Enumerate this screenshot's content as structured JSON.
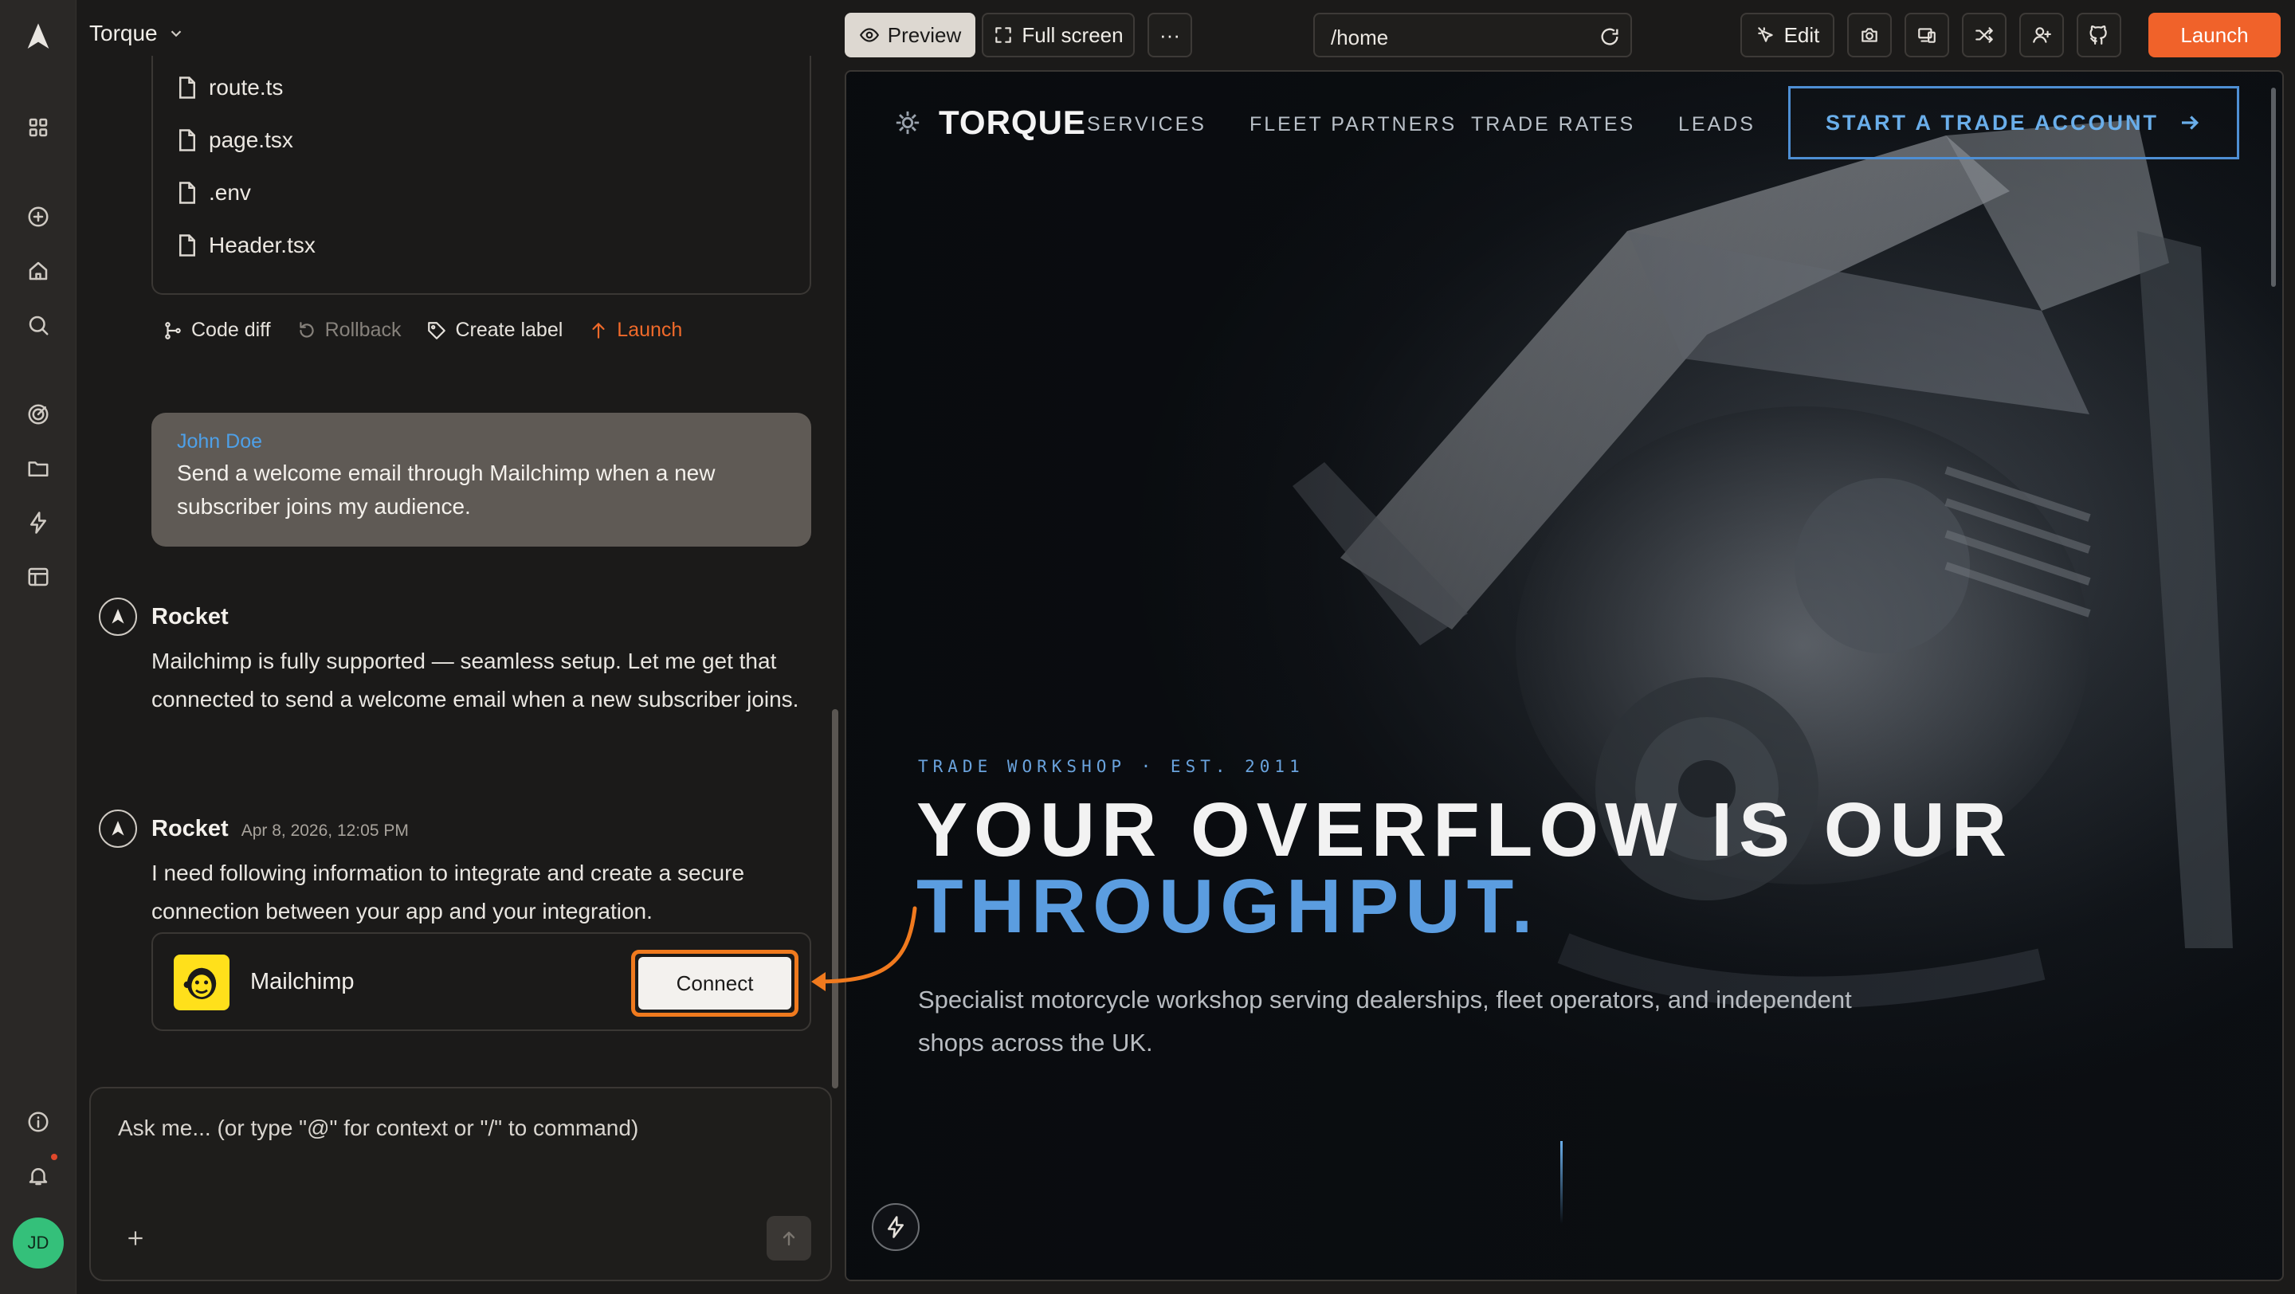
{
  "project": {
    "name": "Torque"
  },
  "files": [
    "route.ts",
    "page.tsx",
    ".env",
    "Header.tsx"
  ],
  "actions": {
    "code_diff": "Code diff",
    "rollback": "Rollback",
    "create_label": "Create label",
    "launch": "Launch"
  },
  "user_message": {
    "author": "John Doe",
    "text": "Send a welcome email through Mailchimp when a new subscriber joins my audience."
  },
  "bot_messages": [
    {
      "name": "Rocket",
      "time": "",
      "text": "Mailchimp is fully supported — seamless setup. Let me get that connected to send a welcome email when a new subscriber joins."
    },
    {
      "name": "Rocket",
      "time": "Apr 8, 2026, 12:05 PM",
      "text": "I need following information to integrate and create a secure connection between your app and your integration."
    }
  ],
  "integration": {
    "name": "Mailchimp",
    "button": "Connect"
  },
  "chat_input": {
    "placeholder": "Ask me... (or type \"@\" for context or \"/\" to command)"
  },
  "toolbar": {
    "preview": "Preview",
    "full_screen": "Full screen",
    "more": "···",
    "url": "/home",
    "edit": "Edit",
    "launch": "Launch"
  },
  "user_avatar": {
    "initials": "JD"
  },
  "site": {
    "brand": "TORQUE",
    "nav": [
      "SERVICES",
      "FLEET PARTNERS",
      "TRADE RATES",
      "LEADS"
    ],
    "cta": "START A TRADE ACCOUNT",
    "eyebrow": "TRADE WORKSHOP · EST. 2011",
    "headline_line1": "YOUR OVERFLOW IS OUR",
    "headline_line2": "THROUGHPUT.",
    "subtitle": "Specialist motorcycle workshop serving dealerships, fleet operators, and independent shops across the UK."
  },
  "colors": {
    "accent_orange": "#f0622a",
    "link_blue": "#4ea0e8",
    "site_blue": "#5b9de0",
    "mailchimp_yellow": "#ffe01b",
    "avatar_green": "#34c07a"
  }
}
